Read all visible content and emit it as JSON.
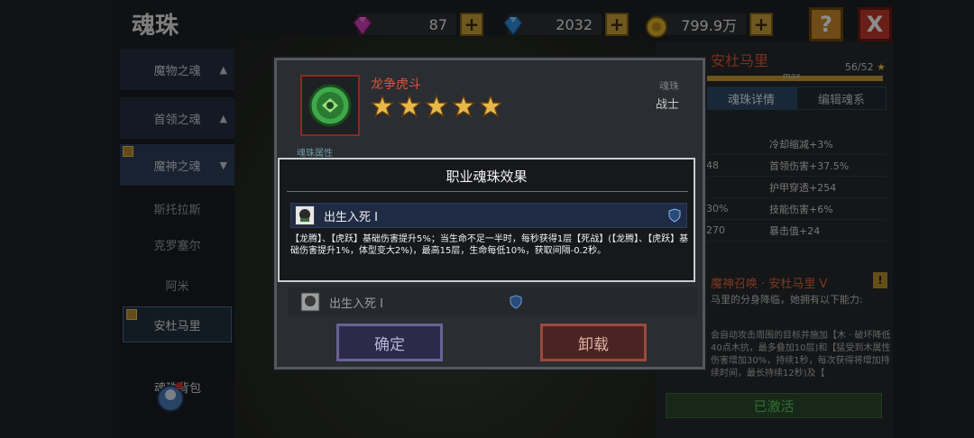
{
  "page": {
    "title": "魂珠"
  },
  "resources": {
    "pink_gem": "87",
    "blue_gem": "2032",
    "gold": "799.9万",
    "plus": "+"
  },
  "top_buttons": {
    "help": "?",
    "close": "X"
  },
  "sidebar": {
    "categories": [
      {
        "label": "魔物之魂"
      },
      {
        "label": "首领之魂"
      },
      {
        "label": "魔神之魂"
      }
    ],
    "sub_items": [
      {
        "label": "斯托拉斯"
      },
      {
        "label": "克罗塞尔"
      },
      {
        "label": "阿米"
      },
      {
        "label": "安杜马里"
      }
    ],
    "bag_label": "魂珠背包"
  },
  "right_panel": {
    "name": "安杜马里",
    "level": "56/52",
    "progress": 1.0,
    "max_label": "max",
    "tabs": [
      {
        "label": "魂珠详情"
      },
      {
        "label": "编辑魂系"
      }
    ],
    "stats": [
      {
        "left": "",
        "right": "冷却缩减+3%"
      },
      {
        "left": "48",
        "right": "首领伤害+37.5%"
      },
      {
        "left": "",
        "right": "护甲穿透+254"
      },
      {
        "left": "30%",
        "right": "技能伤害+6%"
      },
      {
        "left": "270",
        "right": "暴击值+24"
      }
    ],
    "summon_title": "魔神召唤 · 安杜马里 V",
    "summon_desc": "马里的分身降临，她拥有以下能力:",
    "summon_desc2": "会自动攻击周围的目标并施加【木 · 破坏降低40点木抗，最多叠加10层)和【猛受到木属性伤害增加30%，持续1秒，每次获得将增加持续时间，最长持续12秒)及【",
    "activated_label": "已激活"
  },
  "modal": {
    "pearl_name": "龙争虎斗",
    "stars": 5,
    "type_label": "魂珠",
    "type_value": "战士",
    "attr_label": "魂珠属性",
    "bottom_skill_name": "出生入死 I",
    "confirm_label": "确定",
    "unload_label": "卸载"
  },
  "popup": {
    "title": "职业魂珠效果",
    "skill_name": "出生入死 I",
    "description": "【龙腾】、【虎跃】基础伤害提升5%；当生命不足一半时，每秒获得1层【死战】(【龙腾】、【虎跃】基础伤害提升1%，体型变大2%)，最高15层，生命每低10%，获取间隔-0.2秒。"
  },
  "colors": {
    "accent_gold": "#c9a13b",
    "danger_red": "#c0392b",
    "pearl_green": "#3fa84a",
    "name_red": "#d8523a"
  },
  "icons": {
    "pink_gem": "pink-gem-icon",
    "blue_gem": "blue-gem-icon",
    "gold": "gold-coin-icon",
    "help": "help-icon",
    "close": "close-icon",
    "shield": "shield-icon",
    "bag": "bag-icon"
  }
}
